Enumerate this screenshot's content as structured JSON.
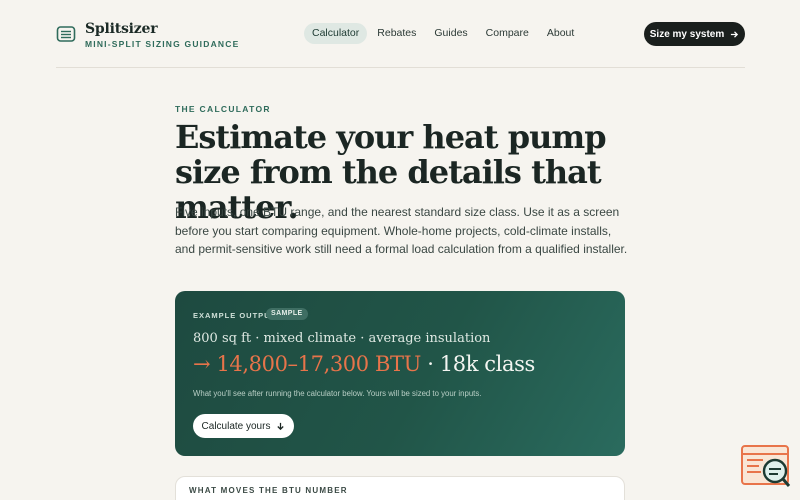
{
  "brand": {
    "name": "Splitsizer",
    "tagline": "MINI-SPLIT SIZING GUIDANCE",
    "icon": "menu-lines-icon"
  },
  "nav": {
    "items": [
      {
        "label": "Calculator",
        "active": true
      },
      {
        "label": "Rebates",
        "active": false
      },
      {
        "label": "Guides",
        "active": false
      },
      {
        "label": "Compare",
        "active": false
      },
      {
        "label": "About",
        "active": false
      }
    ],
    "cta_label": "Size my system",
    "cta_icon": "arrow-right-icon"
  },
  "hero": {
    "eyebrow": "THE CALCULATOR",
    "headline": "Estimate your heat pump size from the details that matter.",
    "intro": "Five inputs, one BTU range, and the nearest standard size class. Use it as a screen before you start comparing equipment. Whole-home projects, cold-climate installs, and permit-sensitive work still need a formal load calculation from a qualified installer."
  },
  "example": {
    "label": "EXAMPLE OUTPUT",
    "badge": "SAMPLE",
    "scenario": "800 sq ft · mixed climate · average insulation",
    "result_range": "→ 14,800–17,300 BTU",
    "result_separator": " · ",
    "result_class": "18k class",
    "note": "What you'll see after running the calculator below. Yours will be sized to your inputs.",
    "button_label": "Calculate yours",
    "button_icon": "arrow-down-icon"
  },
  "next_section": {
    "label": "WHAT MOVES THE BTU NUMBER"
  },
  "colors": {
    "accent": "#2f6b5b",
    "card_bg": "#215548",
    "result_accent": "#e8744a",
    "page_bg": "#f6f4ef"
  }
}
